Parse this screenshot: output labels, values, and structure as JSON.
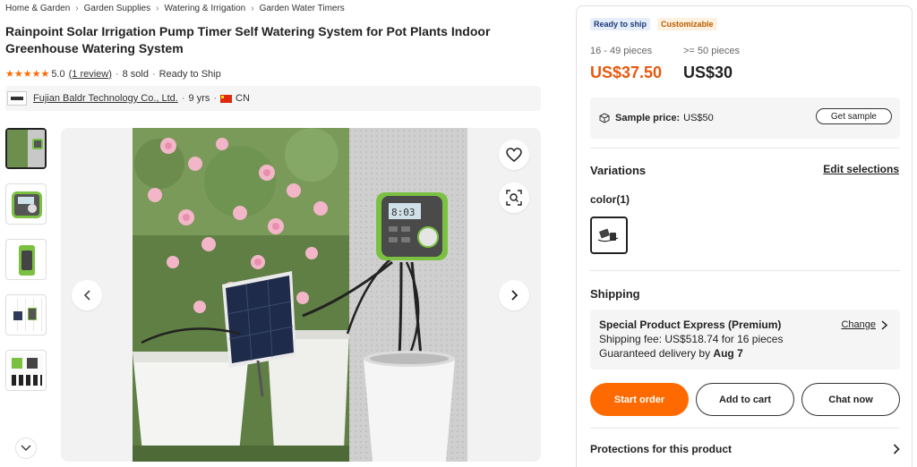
{
  "breadcrumb": [
    "Home & Garden",
    "Garden Supplies",
    "Watering & Irrigation",
    "Garden Water Timers"
  ],
  "product": {
    "title": "Rainpoint Solar Irrigation Pump Timer Self Watering System for Pot Plants Indoor Greenhouse Watering System",
    "rating": "5.0",
    "rating_stars": 5,
    "reviews_link": "(1 review)",
    "sold": "8 sold",
    "shipping_status": "Ready to Ship"
  },
  "supplier": {
    "name": "Fujian Baldr Technology Co., Ltd.",
    "years": "9 yrs",
    "country": "CN"
  },
  "gallery": {
    "thumbnail_count": 5,
    "active_index": 0
  },
  "panel": {
    "tags": [
      "Ready to ship",
      "Customizable"
    ],
    "tiers": [
      {
        "qty": "16 - 49 pieces",
        "price": "US$37.50"
      },
      {
        "qty": ">= 50 pieces",
        "price": "US$30"
      }
    ],
    "sample": {
      "label": "Sample price:",
      "price": "US$50",
      "button": "Get sample"
    },
    "variations": {
      "title": "Variations",
      "edit": "Edit selections",
      "color_label": "color(1)"
    },
    "shipping": {
      "title": "Shipping",
      "method": "Special Product Express (Premium)",
      "change": "Change",
      "fee": "Shipping fee: US$518.74 for 16 pieces",
      "delivery_prefix": "Guaranteed delivery by ",
      "delivery_date": "Aug 7"
    },
    "actions": {
      "start": "Start order",
      "cart": "Add to cart",
      "chat": "Chat now"
    },
    "protections": "Protections for this product"
  },
  "colors": {
    "accent": "#ff6a00",
    "price_orange": "#e8580c",
    "star": "#ff6a00",
    "device_green": "#7ac142"
  }
}
